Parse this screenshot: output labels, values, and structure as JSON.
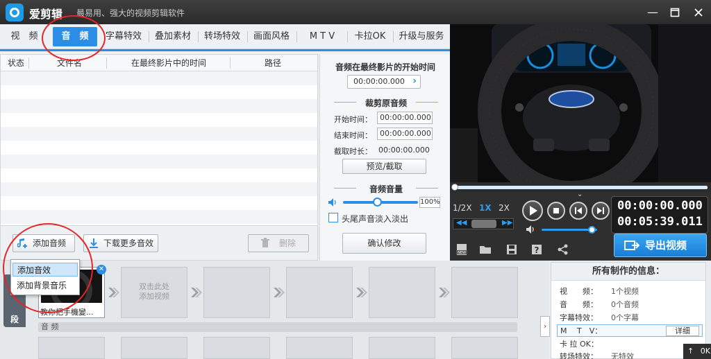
{
  "app": {
    "title": "爱剪辑",
    "subtitle": "最易用、强大的视频剪辑软件",
    "brand_color": "#2b8de5"
  },
  "tabs": [
    {
      "label": "视　频"
    },
    {
      "label": "音　频"
    },
    {
      "label": "字幕特效"
    },
    {
      "label": "叠加素材"
    },
    {
      "label": "转场特效"
    },
    {
      "label": "画面风格"
    },
    {
      "label": "M T V"
    },
    {
      "label": "卡拉OK"
    },
    {
      "label": "升级与服务"
    }
  ],
  "audio_list": {
    "columns": [
      "状态",
      "文件名",
      "在最终影片中的时间",
      "路径"
    ]
  },
  "actions": {
    "add_audio": "添加音频",
    "download_more": "下载更多音效",
    "delete": "删除"
  },
  "add_menu": {
    "items": [
      "添加音效",
      "添加背景音乐"
    ]
  },
  "audio_settings": {
    "start_title": "音频在最终影片的开始时间",
    "start_time": "00:00:00.000",
    "trim_title": "裁剪原音频",
    "start_label": "开始时间：",
    "start_value": "00:00:00.000",
    "end_label": "结束时间：",
    "end_value": "00:00:00.000",
    "duration_label": "截取时长：",
    "duration_value": "00:00:00.000",
    "preview_button": "预览/截取",
    "volume_title": "音频音量",
    "volume_percent": "100%",
    "volume_level": 0.45,
    "fade_label": "头尾声音淡入淡出",
    "confirm_button": "确认修改"
  },
  "player": {
    "speeds": [
      "1/2X",
      "1X",
      "2X"
    ],
    "current_time": "00:00:00.000",
    "total_time": "00:05:39.011",
    "export_button": "导出视频",
    "volume_level": 0.9,
    "seek_progress": 0.0
  },
  "timeline": {
    "left_tab": "段",
    "first_clip_caption": "教你把手機變...",
    "empty_hint_line1": "双击此处",
    "empty_hint_line2": "添加视频",
    "audio_section": "音 频"
  },
  "summary": {
    "title": "所有制作的信息：",
    "rows": [
      {
        "k": "视　　频：",
        "v": "1个视频"
      },
      {
        "k": "音　　频：",
        "v": "0个音频"
      },
      {
        "k": "字幕特效：",
        "v": "0个字幕"
      },
      {
        "k": "M　 T　V：",
        "v": ""
      },
      {
        "k": "卡 拉 OK：",
        "v": ""
      },
      {
        "k": "转场特效：",
        "v": "无特效"
      }
    ],
    "detail_button": "详细"
  },
  "corner": {
    "text": "0K"
  }
}
